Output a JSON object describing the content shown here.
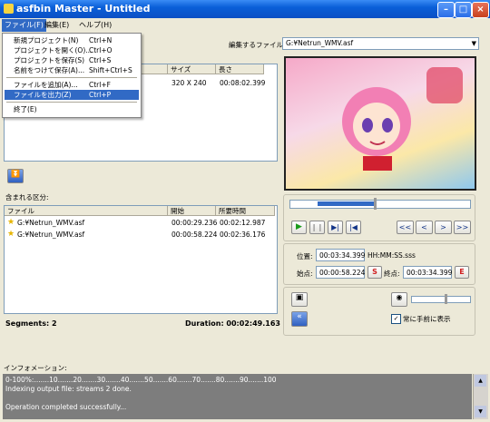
{
  "window": {
    "title": "asfbin Master - Untitled"
  },
  "menubar": {
    "items": [
      {
        "label": "ファイル(F)",
        "active": true
      },
      {
        "label": "編集(E)",
        "active": false
      },
      {
        "label": "ヘルプ(H)",
        "active": false
      }
    ]
  },
  "file_menu": {
    "items": [
      {
        "label": "新規プロジェクト(N)",
        "shortcut": "Ctrl+N"
      },
      {
        "label": "プロジェクトを開く(O)...",
        "shortcut": "Ctrl+O"
      },
      {
        "label": "プロジェクトを保存(S)",
        "shortcut": "Ctrl+S"
      },
      {
        "label": "名前をつけて保存(A)...",
        "shortcut": "Shift+Ctrl+S"
      },
      {
        "label": "ファイルを追加(A)...",
        "shortcut": "Ctrl+F"
      },
      {
        "label": "ファイルを出力(Z)",
        "shortcut": "Ctrl+P"
      },
      {
        "label": "終了(E)",
        "shortcut": ""
      }
    ]
  },
  "file_list": {
    "columns": [
      "サイズ",
      "長さ"
    ],
    "rows": [
      {
        "size": "320 X 240",
        "length": "00:08:02.399"
      }
    ]
  },
  "edit_file": {
    "label": "編集するファイル:",
    "value": "G:¥Netrun_WMV.asf"
  },
  "segments_panel": {
    "label": "含まれる区分:",
    "columns": [
      "ファイル",
      "開始",
      "所要時間"
    ],
    "rows": [
      {
        "file": "G:¥Netrun_WMV.asf",
        "start": "00:00:29.236",
        "duration": "00:02:12.987"
      },
      {
        "file": "G:¥Netrun_WMV.asf",
        "start": "00:00:58.224",
        "duration": "00:02:36.176"
      }
    ],
    "count_text": "Segments: 2",
    "duration_text": "Duration: 00:02:49.163"
  },
  "player": {
    "nav_buttons": [
      "<<",
      "<",
      ">",
      ">>"
    ],
    "position_label": "位置:",
    "position_value": "00:03:34.399",
    "format_hint": "HH:MM:SS.sss",
    "start_label": "始点:",
    "start_value": "00:00:58.224",
    "start_btn": "S",
    "end_label": "終点:",
    "end_value": "00:03:34.399",
    "end_btn": "E",
    "progress": 0.24
  },
  "options": {
    "always_on_top_label": "常に手前に表示",
    "always_on_top_checked": true,
    "volume": 0.6
  },
  "info": {
    "label": "インフォメーション:",
    "lines": [
      "0-100%:.......10.......20.......30.......40.......50.......60.......70.......80.......90.......100",
      "Indexing output file: streams 2  done.",
      "",
      "Operation completed successfully..."
    ]
  },
  "colors": {
    "accent": "#316ac5",
    "title_bar": "#0a5fd8",
    "info_bg": "#7d7d7d"
  }
}
